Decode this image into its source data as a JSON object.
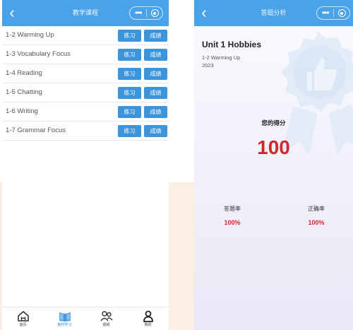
{
  "left_screen": {
    "nav": {
      "back": "‹",
      "title": "教学课程",
      "menu": "•••"
    },
    "lessons": [
      {
        "name": "1-2 Warming Up",
        "practice": "练习",
        "score": "成绩"
      },
      {
        "name": "1-3 Vocabulary Focus",
        "practice": "练习",
        "score": "成绩"
      },
      {
        "name": "1-4 Reading",
        "practice": "练习",
        "score": "成绩"
      },
      {
        "name": "1-5 Chatting",
        "practice": "练习",
        "score": "成绩"
      },
      {
        "name": "1-6 Writing",
        "practice": "练习",
        "score": "成绩"
      },
      {
        "name": "1-7 Grammar Focus",
        "practice": "练习",
        "score": "成绩"
      }
    ],
    "tabbar": [
      {
        "label": "首页",
        "icon": "home-icon"
      },
      {
        "label": "教材学习",
        "icon": "book-icon",
        "active": true
      },
      {
        "label": "视频",
        "icon": "group-icon"
      },
      {
        "label": "我的",
        "icon": "user-icon"
      }
    ]
  },
  "right_screen": {
    "nav": {
      "back": "‹",
      "title": "答题分析",
      "menu": "•••"
    },
    "unit_title": "Unit 1 Hobbies",
    "lesson": "1-2 Warming Up",
    "year": "2023",
    "score_label": "您的得分",
    "score_value": "100",
    "stats": {
      "answer_rate_label": "答题率",
      "answer_rate_value": "100%",
      "accuracy_label": "正确率",
      "accuracy_value": "100%"
    }
  },
  "colors": {
    "primary": "#4aa3e8",
    "button": "#3c95dc",
    "score_red": "#d4272c",
    "page_band": "#fbeee3"
  }
}
